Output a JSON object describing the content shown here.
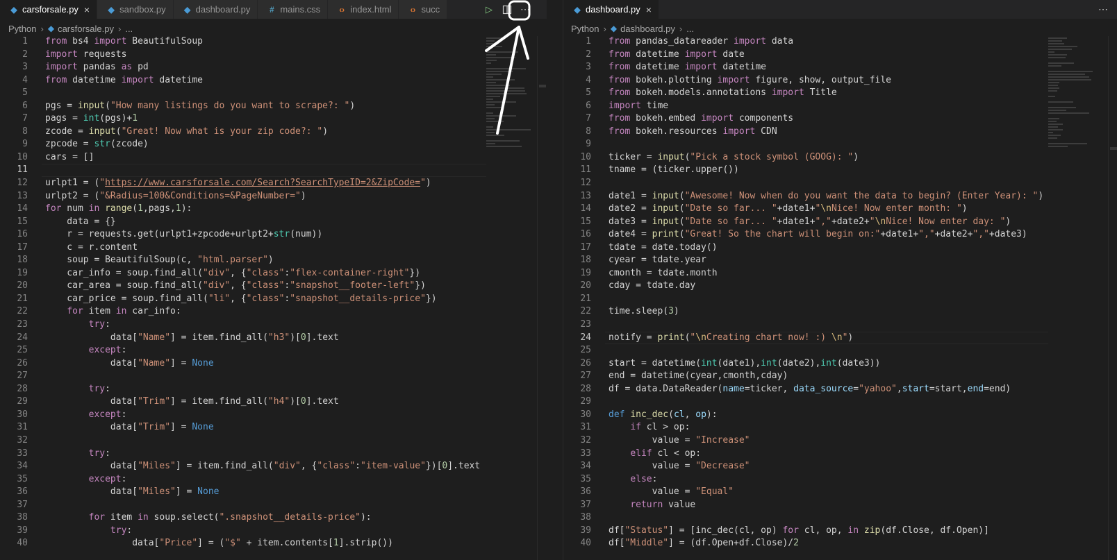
{
  "left": {
    "tabs": [
      {
        "label": "carsforsale.py",
        "icon": "python-icon",
        "active": true
      },
      {
        "label": "sandbox.py",
        "icon": "python-icon",
        "active": false
      },
      {
        "label": "dashboard.py",
        "icon": "python-icon",
        "active": false
      },
      {
        "label": "mains.css",
        "icon": "css-icon",
        "active": false
      },
      {
        "label": "index.html",
        "icon": "html-icon",
        "active": false
      },
      {
        "label": "succ",
        "icon": "html-icon",
        "active": false
      }
    ],
    "breadcrumb": [
      "Python",
      "carsforsale.py",
      "..."
    ],
    "active_line": 11,
    "lines": [
      [
        [
          "kw",
          "from"
        ],
        [
          "tx",
          " bs4 "
        ],
        [
          "kw",
          "import"
        ],
        [
          "tx",
          " BeautifulSoup"
        ]
      ],
      [
        [
          "kw",
          "import"
        ],
        [
          "tx",
          " requests"
        ]
      ],
      [
        [
          "kw",
          "import"
        ],
        [
          "tx",
          " pandas "
        ],
        [
          "kw",
          "as"
        ],
        [
          "tx",
          " pd"
        ]
      ],
      [
        [
          "kw",
          "from"
        ],
        [
          "tx",
          " datetime "
        ],
        [
          "kw",
          "import"
        ],
        [
          "tx",
          " datetime"
        ]
      ],
      [],
      [
        [
          "tx",
          "pgs = "
        ],
        [
          "fn",
          "input"
        ],
        [
          "tx",
          "("
        ],
        [
          "st",
          "\"How many listings do you want to scrape?: \""
        ],
        [
          "tx",
          ")"
        ]
      ],
      [
        [
          "tx",
          "pags = "
        ],
        [
          "bi",
          "int"
        ],
        [
          "tx",
          "(pgs)+"
        ],
        [
          "nu",
          "1"
        ]
      ],
      [
        [
          "tx",
          "zcode = "
        ],
        [
          "fn",
          "input"
        ],
        [
          "tx",
          "("
        ],
        [
          "st",
          "\"Great! Now what is your zip code?: \""
        ],
        [
          "tx",
          ")"
        ]
      ],
      [
        [
          "tx",
          "zpcode = "
        ],
        [
          "bi",
          "str"
        ],
        [
          "tx",
          "(zcode)"
        ]
      ],
      [
        [
          "tx",
          "cars = []"
        ]
      ],
      [],
      [
        [
          "tx",
          "urlpt1 = ("
        ],
        [
          "st",
          "\""
        ],
        [
          "lnk",
          "https://www.carsforsale.com/Search?SearchTypeID=2&ZipCode="
        ],
        [
          "st",
          "\""
        ],
        [
          "tx",
          ")"
        ]
      ],
      [
        [
          "tx",
          "urlpt2 = ("
        ],
        [
          "st",
          "\"&Radius=100&Conditions=&PageNumber=\""
        ],
        [
          "tx",
          ")"
        ]
      ],
      [
        [
          "kw",
          "for"
        ],
        [
          "tx",
          " num "
        ],
        [
          "kw",
          "in"
        ],
        [
          "tx",
          " "
        ],
        [
          "fn",
          "range"
        ],
        [
          "tx",
          "("
        ],
        [
          "nu",
          "1"
        ],
        [
          "tx",
          ",pags,"
        ],
        [
          "nu",
          "1"
        ],
        [
          "tx",
          "):"
        ]
      ],
      [
        [
          "tx",
          "    data = {}"
        ]
      ],
      [
        [
          "tx",
          "    r = requests.get(urlpt1+zpcode+urlpt2+"
        ],
        [
          "bi",
          "str"
        ],
        [
          "tx",
          "(num))"
        ]
      ],
      [
        [
          "tx",
          "    c = r.content"
        ]
      ],
      [
        [
          "tx",
          "    soup = BeautifulSoup(c, "
        ],
        [
          "st",
          "\"html.parser\""
        ],
        [
          "tx",
          ")"
        ]
      ],
      [
        [
          "tx",
          "    car_info = soup.find_all("
        ],
        [
          "st",
          "\"div\""
        ],
        [
          "tx",
          ", {"
        ],
        [
          "st",
          "\"class\""
        ],
        [
          "tx",
          ":"
        ],
        [
          "st",
          "\"flex-container-right\""
        ],
        [
          "tx",
          "})"
        ]
      ],
      [
        [
          "tx",
          "    car_area = soup.find_all("
        ],
        [
          "st",
          "\"div\""
        ],
        [
          "tx",
          ", {"
        ],
        [
          "st",
          "\"class\""
        ],
        [
          "tx",
          ":"
        ],
        [
          "st",
          "\"snapshot__footer-left\""
        ],
        [
          "tx",
          "})"
        ]
      ],
      [
        [
          "tx",
          "    car_price = soup.find_all("
        ],
        [
          "st",
          "\"li\""
        ],
        [
          "tx",
          ", {"
        ],
        [
          "st",
          "\"class\""
        ],
        [
          "tx",
          ":"
        ],
        [
          "st",
          "\"snapshot__details-price\""
        ],
        [
          "tx",
          "})"
        ]
      ],
      [
        [
          "tx",
          "    "
        ],
        [
          "kw",
          "for"
        ],
        [
          "tx",
          " item "
        ],
        [
          "kw",
          "in"
        ],
        [
          "tx",
          " car_info:"
        ]
      ],
      [
        [
          "tx",
          "        "
        ],
        [
          "kw",
          "try"
        ],
        [
          "tx",
          ":"
        ]
      ],
      [
        [
          "tx",
          "            data["
        ],
        [
          "st",
          "\"Name\""
        ],
        [
          "tx",
          "] = item.find_all("
        ],
        [
          "st",
          "\"h3\""
        ],
        [
          "tx",
          ")["
        ],
        [
          "nu",
          "0"
        ],
        [
          "tx",
          "].text"
        ]
      ],
      [
        [
          "tx",
          "        "
        ],
        [
          "kw",
          "except"
        ],
        [
          "tx",
          ":"
        ]
      ],
      [
        [
          "tx",
          "            data["
        ],
        [
          "st",
          "\"Name\""
        ],
        [
          "tx",
          "] = "
        ],
        [
          "co",
          "None"
        ]
      ],
      [],
      [
        [
          "tx",
          "        "
        ],
        [
          "kw",
          "try"
        ],
        [
          "tx",
          ":"
        ]
      ],
      [
        [
          "tx",
          "            data["
        ],
        [
          "st",
          "\"Trim\""
        ],
        [
          "tx",
          "] = item.find_all("
        ],
        [
          "st",
          "\"h4\""
        ],
        [
          "tx",
          ")["
        ],
        [
          "nu",
          "0"
        ],
        [
          "tx",
          "].text"
        ]
      ],
      [
        [
          "tx",
          "        "
        ],
        [
          "kw",
          "except"
        ],
        [
          "tx",
          ":"
        ]
      ],
      [
        [
          "tx",
          "            data["
        ],
        [
          "st",
          "\"Trim\""
        ],
        [
          "tx",
          "] = "
        ],
        [
          "co",
          "None"
        ]
      ],
      [],
      [
        [
          "tx",
          "        "
        ],
        [
          "kw",
          "try"
        ],
        [
          "tx",
          ":"
        ]
      ],
      [
        [
          "tx",
          "            data["
        ],
        [
          "st",
          "\"Miles\""
        ],
        [
          "tx",
          "] = item.find_all("
        ],
        [
          "st",
          "\"div\""
        ],
        [
          "tx",
          ", {"
        ],
        [
          "st",
          "\"class\""
        ],
        [
          "tx",
          ":"
        ],
        [
          "st",
          "\"item-value\""
        ],
        [
          "tx",
          "})["
        ],
        [
          "nu",
          "0"
        ],
        [
          "tx",
          "].text"
        ]
      ],
      [
        [
          "tx",
          "        "
        ],
        [
          "kw",
          "except"
        ],
        [
          "tx",
          ":"
        ]
      ],
      [
        [
          "tx",
          "            data["
        ],
        [
          "st",
          "\"Miles\""
        ],
        [
          "tx",
          "] = "
        ],
        [
          "co",
          "None"
        ]
      ],
      [],
      [
        [
          "tx",
          "        "
        ],
        [
          "kw",
          "for"
        ],
        [
          "tx",
          " item "
        ],
        [
          "kw",
          "in"
        ],
        [
          "tx",
          " soup.select("
        ],
        [
          "st",
          "\".snapshot__details-price\""
        ],
        [
          "tx",
          "):"
        ]
      ],
      [
        [
          "tx",
          "            "
        ],
        [
          "kw",
          "try"
        ],
        [
          "tx",
          ":"
        ]
      ],
      [
        [
          "tx",
          "                data["
        ],
        [
          "st",
          "\"Price\""
        ],
        [
          "tx",
          "] = ("
        ],
        [
          "st",
          "\"$\""
        ],
        [
          "tx",
          " + item.contents["
        ],
        [
          "nu",
          "1"
        ],
        [
          "tx",
          "].strip())"
        ]
      ]
    ]
  },
  "right": {
    "tabs": [
      {
        "label": "dashboard.py",
        "icon": "python-icon",
        "active": true
      }
    ],
    "breadcrumb": [
      "Python",
      "dashboard.py",
      "..."
    ],
    "active_line": 24,
    "lines": [
      [
        [
          "kw",
          "from"
        ],
        [
          "tx",
          " pandas_datareader "
        ],
        [
          "kw",
          "import"
        ],
        [
          "tx",
          " data"
        ]
      ],
      [
        [
          "kw",
          "from"
        ],
        [
          "tx",
          " datetime "
        ],
        [
          "kw",
          "import"
        ],
        [
          "tx",
          " date"
        ]
      ],
      [
        [
          "kw",
          "from"
        ],
        [
          "tx",
          " datetime "
        ],
        [
          "kw",
          "import"
        ],
        [
          "tx",
          " datetime"
        ]
      ],
      [
        [
          "kw",
          "from"
        ],
        [
          "tx",
          " bokeh.plotting "
        ],
        [
          "kw",
          "import"
        ],
        [
          "tx",
          " figure, show, output_file"
        ]
      ],
      [
        [
          "kw",
          "from"
        ],
        [
          "tx",
          " bokeh.models.annotations "
        ],
        [
          "kw",
          "import"
        ],
        [
          "tx",
          " Title"
        ]
      ],
      [
        [
          "kw",
          "import"
        ],
        [
          "tx",
          " time"
        ]
      ],
      [
        [
          "kw",
          "from"
        ],
        [
          "tx",
          " bokeh.embed "
        ],
        [
          "kw",
          "import"
        ],
        [
          "tx",
          " components"
        ]
      ],
      [
        [
          "kw",
          "from"
        ],
        [
          "tx",
          " bokeh.resources "
        ],
        [
          "kw",
          "import"
        ],
        [
          "tx",
          " CDN"
        ]
      ],
      [],
      [
        [
          "tx",
          "ticker = "
        ],
        [
          "fn",
          "input"
        ],
        [
          "tx",
          "("
        ],
        [
          "st",
          "\"Pick a stock symbol (GOOG): \""
        ],
        [
          "tx",
          ")"
        ]
      ],
      [
        [
          "tx",
          "tname = (ticker.upper())"
        ]
      ],
      [],
      [
        [
          "tx",
          "date1 = "
        ],
        [
          "fn",
          "input"
        ],
        [
          "tx",
          "("
        ],
        [
          "st",
          "\"Awesome! Now when do you want the data to begin? (Enter Year): \""
        ],
        [
          "tx",
          ")"
        ]
      ],
      [
        [
          "tx",
          "date2 = "
        ],
        [
          "fn",
          "input"
        ],
        [
          "tx",
          "("
        ],
        [
          "st",
          "\"Date so far... \""
        ],
        [
          "tx",
          "+date1+"
        ],
        [
          "st",
          "\""
        ],
        [
          "es",
          "\\n"
        ],
        [
          "st",
          "Nice! Now enter month: \""
        ],
        [
          "tx",
          ")"
        ]
      ],
      [
        [
          "tx",
          "date3 = "
        ],
        [
          "fn",
          "input"
        ],
        [
          "tx",
          "("
        ],
        [
          "st",
          "\"Date so far... \""
        ],
        [
          "tx",
          "+date1+"
        ],
        [
          "st",
          "\",\""
        ],
        [
          "tx",
          "+date2+"
        ],
        [
          "st",
          "\""
        ],
        [
          "es",
          "\\n"
        ],
        [
          "st",
          "Nice! Now enter day: \""
        ],
        [
          "tx",
          ")"
        ]
      ],
      [
        [
          "tx",
          "date4 = "
        ],
        [
          "fn",
          "print"
        ],
        [
          "tx",
          "("
        ],
        [
          "st",
          "\"Great! So the chart will begin on:\""
        ],
        [
          "tx",
          "+date1+"
        ],
        [
          "st",
          "\",\""
        ],
        [
          "tx",
          "+date2+"
        ],
        [
          "st",
          "\",\""
        ],
        [
          "tx",
          "+date3)"
        ]
      ],
      [
        [
          "tx",
          "tdate = date.today()"
        ]
      ],
      [
        [
          "tx",
          "cyear = tdate.year"
        ]
      ],
      [
        [
          "tx",
          "cmonth = tdate.month"
        ]
      ],
      [
        [
          "tx",
          "cday = tdate.day"
        ]
      ],
      [],
      [
        [
          "tx",
          "time.sleep("
        ],
        [
          "nu",
          "3"
        ],
        [
          "tx",
          ")"
        ]
      ],
      [],
      [
        [
          "tx",
          "notify = "
        ],
        [
          "fn",
          "print"
        ],
        [
          "tx",
          "("
        ],
        [
          "st",
          "\""
        ],
        [
          "es",
          "\\n"
        ],
        [
          "st",
          "Creating chart now! :) "
        ],
        [
          "es",
          "\\n"
        ],
        [
          "st",
          "\""
        ],
        [
          "tx",
          ")"
        ]
      ],
      [],
      [
        [
          "tx",
          "start = datetime("
        ],
        [
          "bi",
          "int"
        ],
        [
          "tx",
          "(date1),"
        ],
        [
          "bi",
          "int"
        ],
        [
          "tx",
          "(date2),"
        ],
        [
          "bi",
          "int"
        ],
        [
          "tx",
          "(date3))"
        ]
      ],
      [
        [
          "tx",
          "end = datetime(cyear,cmonth,cday)"
        ]
      ],
      [
        [
          "tx",
          "df = data.DataReader("
        ],
        [
          "pa",
          "name"
        ],
        [
          "tx",
          "=ticker, "
        ],
        [
          "pa",
          "data_source"
        ],
        [
          "tx",
          "="
        ],
        [
          "st",
          "\"yahoo\""
        ],
        [
          "tx",
          ","
        ],
        [
          "pa",
          "start"
        ],
        [
          "tx",
          "=start,"
        ],
        [
          "pa",
          "end"
        ],
        [
          "tx",
          "=end)"
        ]
      ],
      [],
      [
        [
          "co",
          "def"
        ],
        [
          "tx",
          " "
        ],
        [
          "fn",
          "inc_dec"
        ],
        [
          "tx",
          "("
        ],
        [
          "pa",
          "cl"
        ],
        [
          "tx",
          ", "
        ],
        [
          "pa",
          "op"
        ],
        [
          "tx",
          "):"
        ]
      ],
      [
        [
          "tx",
          "    "
        ],
        [
          "kw",
          "if"
        ],
        [
          "tx",
          " cl > op:"
        ]
      ],
      [
        [
          "tx",
          "        value = "
        ],
        [
          "st",
          "\"Increase\""
        ]
      ],
      [
        [
          "tx",
          "    "
        ],
        [
          "kw",
          "elif"
        ],
        [
          "tx",
          " cl < op:"
        ]
      ],
      [
        [
          "tx",
          "        value = "
        ],
        [
          "st",
          "\"Decrease\""
        ]
      ],
      [
        [
          "tx",
          "    "
        ],
        [
          "kw",
          "else"
        ],
        [
          "tx",
          ":"
        ]
      ],
      [
        [
          "tx",
          "        value = "
        ],
        [
          "st",
          "\"Equal\""
        ]
      ],
      [
        [
          "tx",
          "    "
        ],
        [
          "kw",
          "return"
        ],
        [
          "tx",
          " value"
        ]
      ],
      [],
      [
        [
          "tx",
          "df["
        ],
        [
          "st",
          "\"Status\""
        ],
        [
          "tx",
          "] = [inc_dec(cl, op) "
        ],
        [
          "kw",
          "for"
        ],
        [
          "tx",
          " cl, op, "
        ],
        [
          "kw",
          "in"
        ],
        [
          "tx",
          " "
        ],
        [
          "fn",
          "zip"
        ],
        [
          "tx",
          "(df.Close, df.Open)]"
        ]
      ],
      [
        [
          "tx",
          "df["
        ],
        [
          "st",
          "\"Middle\""
        ],
        [
          "tx",
          "] = (df.Open+df.Close)/"
        ],
        [
          "nu",
          "2"
        ]
      ]
    ]
  },
  "colors": {
    "background": "#1e1e1e",
    "annotation": "#ffffff",
    "python_icon": "#4a9bd6",
    "css_icon": "#519aba",
    "html_icon": "#e37933"
  }
}
